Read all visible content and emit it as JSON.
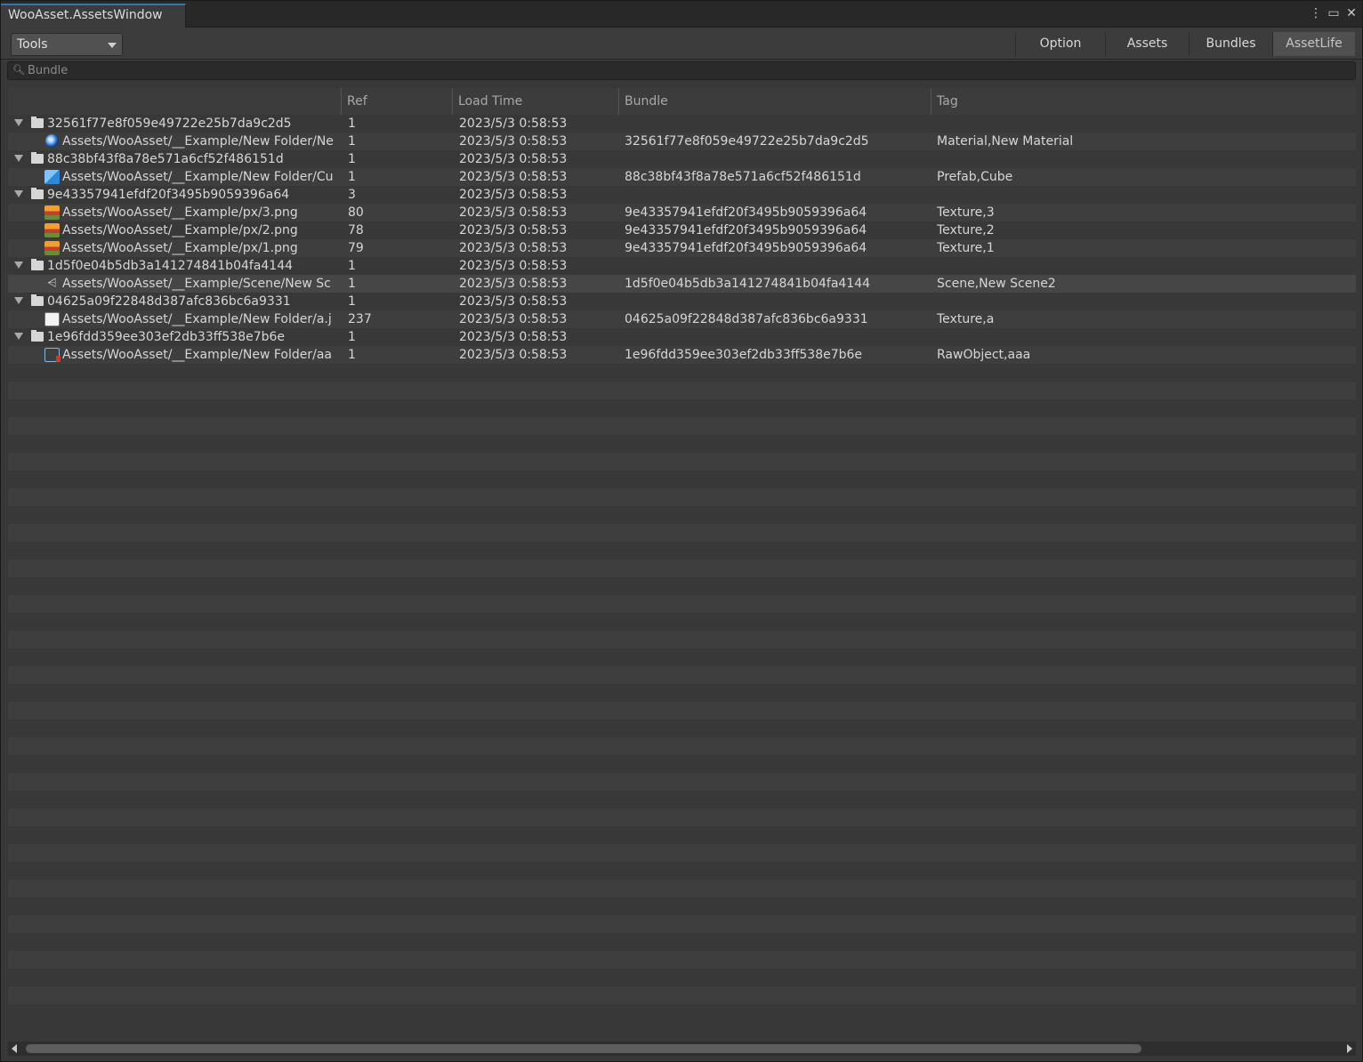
{
  "window": {
    "tab_title": "WooAsset.AssetsWindow",
    "icons": [
      "more-vert-icon",
      "maximize-icon",
      "close-icon"
    ]
  },
  "toolbar": {
    "tools_label": "Tools",
    "tabs": [
      {
        "label": "Option",
        "active": false
      },
      {
        "label": "Assets",
        "active": false
      },
      {
        "label": "Bundles",
        "active": false
      },
      {
        "label": "AssetLife",
        "active": true
      }
    ]
  },
  "search": {
    "placeholder": "Bundle",
    "value": ""
  },
  "table": {
    "columns": [
      "Ref",
      "Load Time",
      "Bundle",
      "Tag"
    ],
    "rows": [
      {
        "kind": "group",
        "name": "32561f77e8f059e49722e25b7da9c2d5",
        "ref": "1",
        "time": "2023/5/3 0:58:53",
        "bundle": "",
        "tag": ""
      },
      {
        "kind": "asset",
        "icon": "material-icon",
        "name": "Assets/WooAsset/__Example/New Folder/Ne",
        "ref": "1",
        "time": "2023/5/3 0:58:53",
        "bundle": "32561f77e8f059e49722e25b7da9c2d5",
        "tag": "Material,New Material"
      },
      {
        "kind": "group",
        "name": "88c38bf43f8a78e571a6cf52f486151d",
        "ref": "1",
        "time": "2023/5/3 0:58:53",
        "bundle": "",
        "tag": ""
      },
      {
        "kind": "asset",
        "icon": "prefab-icon",
        "name": "Assets/WooAsset/__Example/New Folder/Cu",
        "ref": "1",
        "time": "2023/5/3 0:58:53",
        "bundle": "88c38bf43f8a78e571a6cf52f486151d",
        "tag": "Prefab,Cube"
      },
      {
        "kind": "group",
        "name": "9e43357941efdf20f3495b9059396a64",
        "ref": "3",
        "time": "2023/5/3 0:58:53",
        "bundle": "",
        "tag": ""
      },
      {
        "kind": "asset",
        "icon": "texture-icon",
        "name": "Assets/WooAsset/__Example/px/3.png",
        "ref": "80",
        "time": "2023/5/3 0:58:53",
        "bundle": "9e43357941efdf20f3495b9059396a64",
        "tag": "Texture,3"
      },
      {
        "kind": "asset",
        "icon": "texture-icon",
        "name": "Assets/WooAsset/__Example/px/2.png",
        "ref": "78",
        "time": "2023/5/3 0:58:53",
        "bundle": "9e43357941efdf20f3495b9059396a64",
        "tag": "Texture,2"
      },
      {
        "kind": "asset",
        "icon": "texture-icon",
        "name": "Assets/WooAsset/__Example/px/1.png",
        "ref": "79",
        "time": "2023/5/3 0:58:53",
        "bundle": "9e43357941efdf20f3495b9059396a64",
        "tag": "Texture,1"
      },
      {
        "kind": "group",
        "name": "1d5f0e04b5db3a141274841b04fa4144",
        "ref": "1",
        "time": "2023/5/3 0:58:53",
        "bundle": "",
        "tag": ""
      },
      {
        "kind": "asset",
        "icon": "scene-icon",
        "name": "Assets/WooAsset/__Example/Scene/New Sc",
        "ref": "1",
        "time": "2023/5/3 0:58:53",
        "bundle": "1d5f0e04b5db3a141274841b04fa4144",
        "tag": "Scene,New Scene2",
        "selected": true
      },
      {
        "kind": "group",
        "name": "04625a09f22848d387afc836bc6a9331",
        "ref": "1",
        "time": "2023/5/3 0:58:53",
        "bundle": "",
        "tag": ""
      },
      {
        "kind": "asset",
        "icon": "image-icon",
        "name": "Assets/WooAsset/__Example/New Folder/a.j",
        "ref": "237",
        "time": "2023/5/3 0:58:53",
        "bundle": "04625a09f22848d387afc836bc6a9331",
        "tag": "Texture,a"
      },
      {
        "kind": "group",
        "name": "1e96fdd359ee303ef2db33ff538e7b6e",
        "ref": "1",
        "time": "2023/5/3 0:58:53",
        "bundle": "",
        "tag": ""
      },
      {
        "kind": "asset",
        "icon": "raw-object-icon",
        "name": "Assets/WooAsset/__Example/New Folder/aa",
        "ref": "1",
        "time": "2023/5/3 0:58:53",
        "bundle": "1e96fdd359ee303ef2db33ff538e7b6e",
        "tag": "RawObject,aaa"
      }
    ]
  }
}
